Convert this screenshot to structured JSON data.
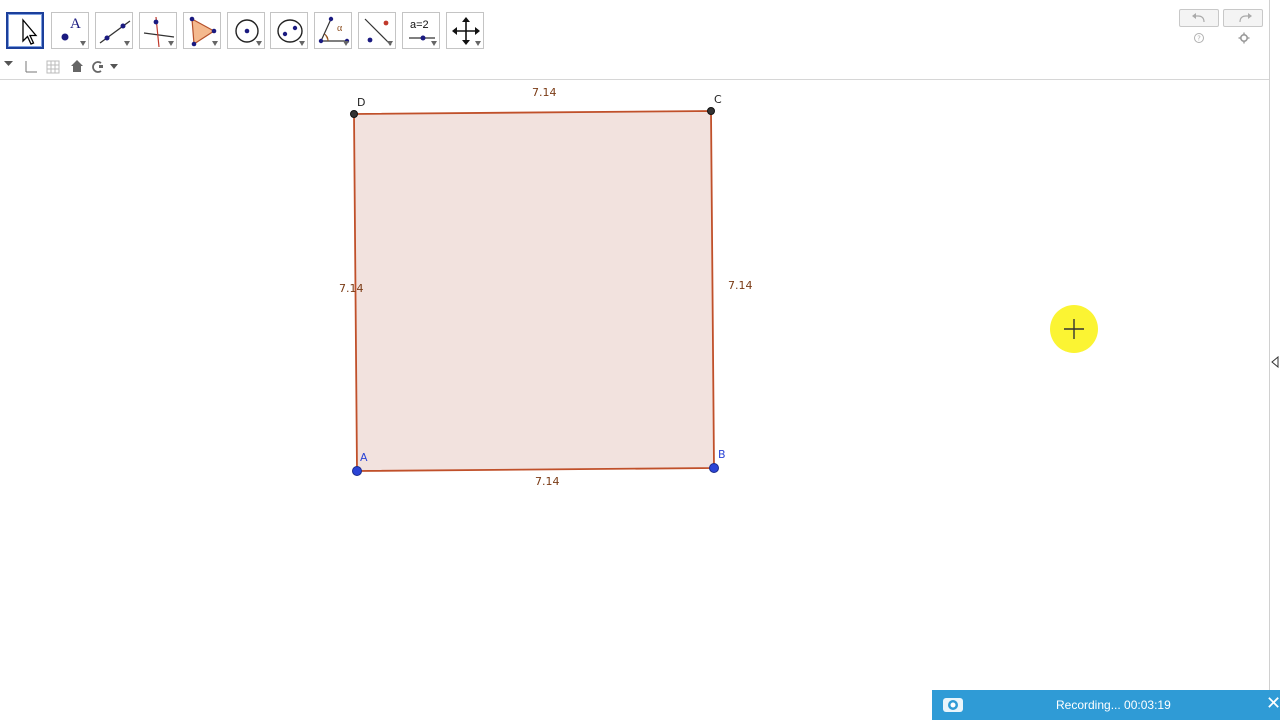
{
  "toolbar": {
    "tools": [
      {
        "name": "move-tool",
        "active": true
      },
      {
        "name": "point-tool",
        "glyph": "A"
      },
      {
        "name": "line-tool"
      },
      {
        "name": "perpendicular-line-tool"
      },
      {
        "name": "polygon-tool"
      },
      {
        "name": "circle-tool"
      },
      {
        "name": "conic-tool"
      },
      {
        "name": "angle-tool",
        "glyph": "α"
      },
      {
        "name": "reflect-tool"
      },
      {
        "name": "slider-tool",
        "glyph": "a=2"
      },
      {
        "name": "move-graphics-view-tool"
      }
    ],
    "undo_icon": "undo-icon",
    "redo_icon": "redo-icon",
    "help_icon": "help-icon",
    "settings_icon": "gear-icon"
  },
  "stylebar": {
    "icons": [
      "toggle-stylebar-icon",
      "axes-icon",
      "grid-icon",
      "home-icon",
      "point-capturing-icon"
    ]
  },
  "geometry": {
    "points": [
      {
        "label": "A",
        "color": "#2b44d6"
      },
      {
        "label": "B",
        "color": "#2b44d6"
      },
      {
        "label": "C",
        "color": "#333333"
      },
      {
        "label": "D",
        "color": "#333333"
      }
    ],
    "segment_lengths": {
      "top": "7.14",
      "bottom": "7.14",
      "left": "7.14",
      "right": "7.14"
    },
    "polygon_fill": "#f2e2de",
    "edge_color": "#c0502a"
  },
  "cursor_highlight_color": "#fbf433",
  "recording": {
    "text": "Recording... 00:03:19",
    "close_glyph": "✕"
  }
}
